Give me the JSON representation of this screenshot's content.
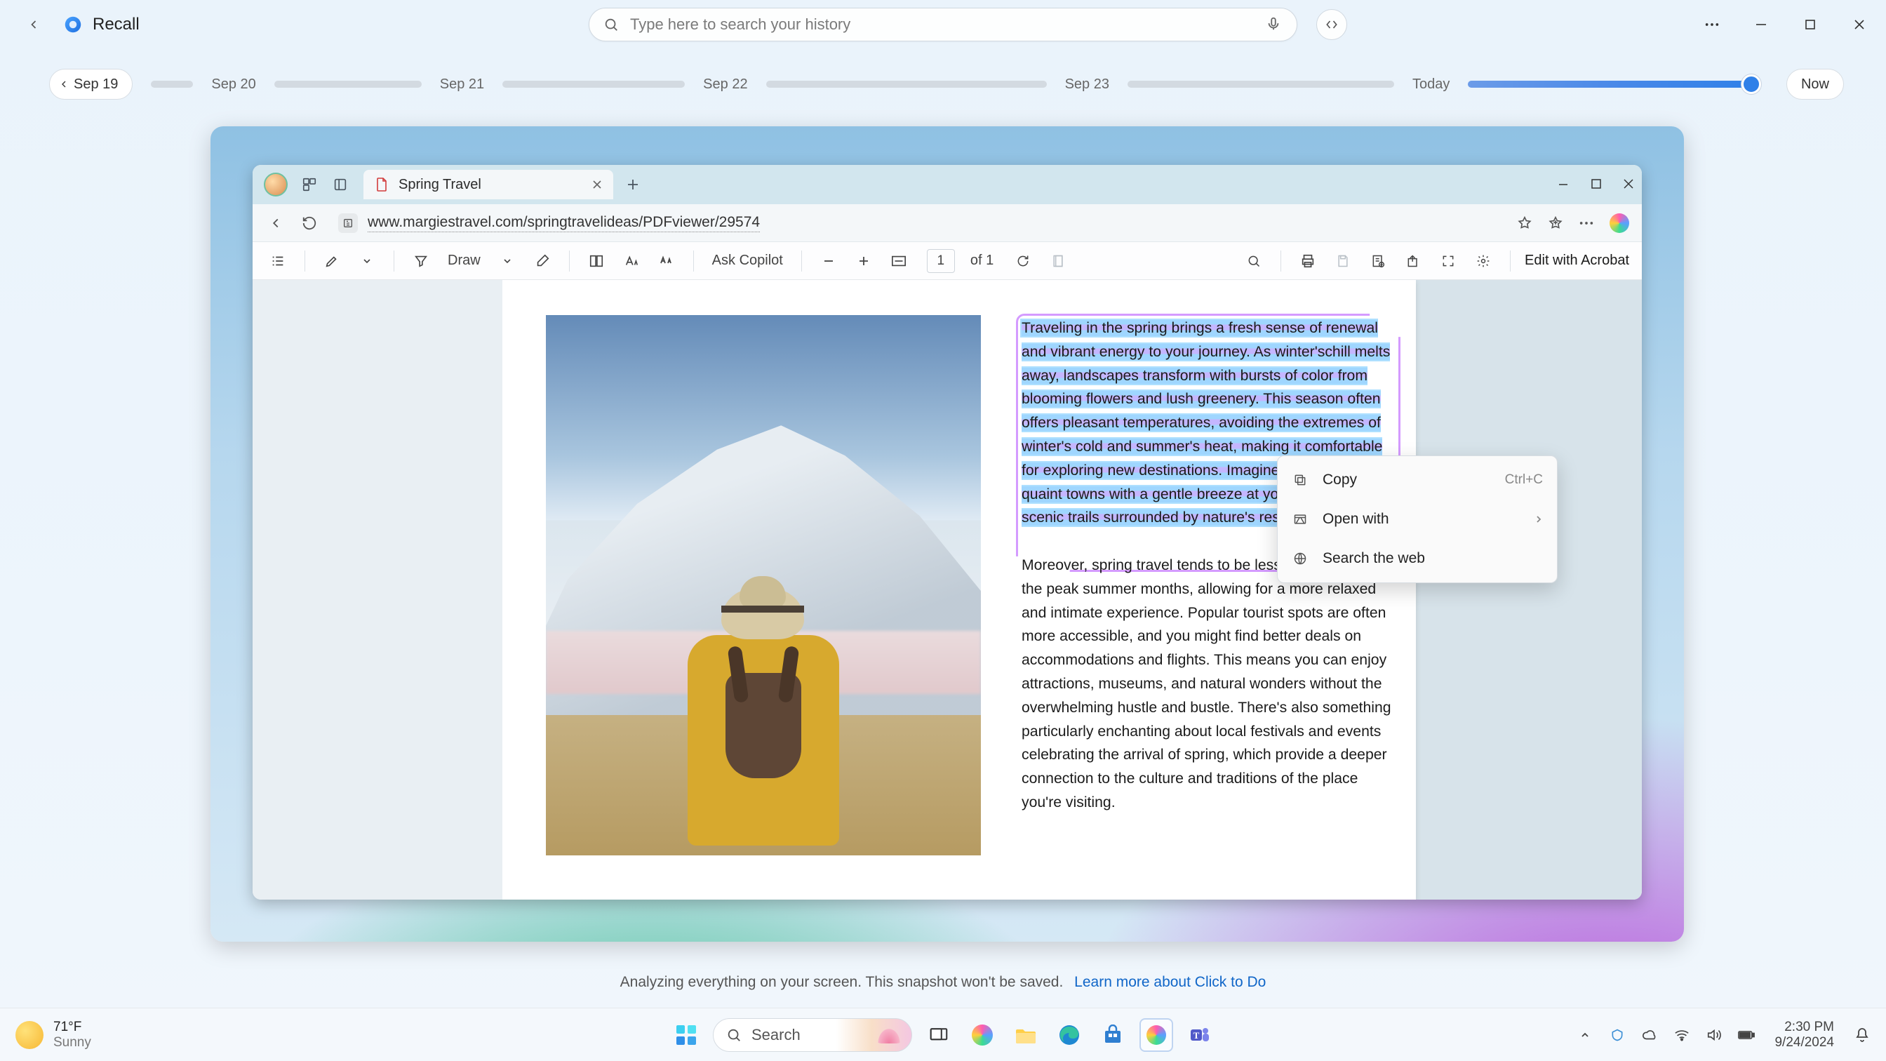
{
  "recall": {
    "title": "Recall",
    "search_placeholder": "Type here to search your history"
  },
  "timeline": {
    "start_pill": "Sep 19",
    "dates": [
      "Sep 20",
      "Sep 21",
      "Sep 22",
      "Sep 23"
    ],
    "today_label": "Today",
    "now_label": "Now"
  },
  "browser": {
    "tab_title": "Spring Travel",
    "url": "www.margiestravel.com/springtravelideas/PDFviewer/29574"
  },
  "pdf_toolbar": {
    "draw": "Draw",
    "ask_copilot": "Ask Copilot",
    "page_current": "1",
    "page_total": "of 1",
    "edit_acrobat": "Edit with Acrobat"
  },
  "pdf_text": {
    "selected": "Traveling in the spring brings a fresh sense of renewal and vibrant energy to your journey. As winter'schill melts away, landscapes transform with bursts of color from blooming flowers and lush greenery. This season often offers pleasant temperatures, avoiding the extremes of winter's cold and summer's heat, making it comfortable for exploring new destinations. Imagine strolling through quaint towns with a gentle breeze at your back or hiking scenic trails surrounded by nature's resurgence.",
    "rest": "Moreover, spring travel tends to be less crowded than the peak summer months, allowing for a more relaxed and intimate experience. Popular tourist spots are often more accessible, and you might find better deals on accommodations and flights. This means you can enjoy attractions, museums, and natural wonders without the overwhelming hustle and bustle. There's also something particularly enchanting about local festivals and events celebrating the arrival of spring, which provide a deeper connection to the culture and traditions of the place you're visiting."
  },
  "context_menu": {
    "copy": "Copy",
    "copy_shortcut": "Ctrl+C",
    "open_with": "Open with",
    "search_web": "Search the web"
  },
  "status": {
    "text": "Analyzing everything on your screen. This snapshot won't be saved.",
    "link": "Learn more about Click to Do"
  },
  "taskbar": {
    "temp": "71°F",
    "condition": "Sunny",
    "search": "Search",
    "time": "2:30 PM",
    "date": "9/24/2024"
  }
}
